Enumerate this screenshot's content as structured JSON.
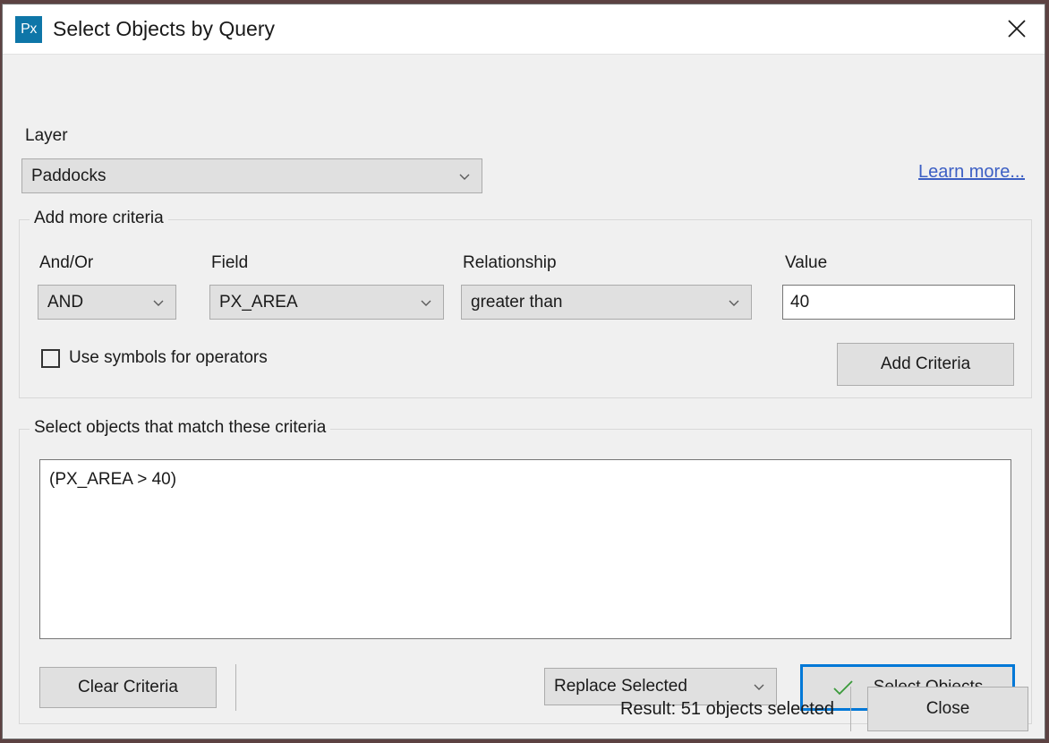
{
  "window": {
    "title": "Select Objects by Query",
    "app_icon": "px-app-icon",
    "app_icon_text": "Px",
    "close_icon": "close-icon"
  },
  "layer": {
    "label": "Layer",
    "selected": "Paddocks",
    "chevron_icon": "chevron-down-icon"
  },
  "learn_more": {
    "label": "Learn more...",
    "color": "#3c5fc4"
  },
  "criteria": {
    "group_title": "Add more criteria",
    "andor": {
      "label": "And/Or",
      "selected": "AND"
    },
    "field": {
      "label": "Field",
      "selected": "PX_AREA"
    },
    "relationship": {
      "label": "Relationship",
      "selected": "greater than"
    },
    "value": {
      "label": "Value",
      "text": "40",
      "placeholder": ""
    },
    "use_symbols": {
      "label": "Use symbols for operators",
      "checked": false
    },
    "add_button": "Add Criteria"
  },
  "match": {
    "group_title": "Select objects that match these criteria",
    "query_text": "(PX_AREA > 40)",
    "clear_button": "Clear Criteria",
    "mode": {
      "selected": "Replace Selected"
    },
    "select_button": "Select Objects",
    "check_icon": "check-icon",
    "check_color": "#3a9a3a"
  },
  "footer": {
    "result": "Result: 51 objects selected",
    "close_button": "Close"
  },
  "theme": {
    "accent": "#0078d7",
    "dialog_bg": "#f0f0f0",
    "icon_blue": "#0e76a8"
  }
}
